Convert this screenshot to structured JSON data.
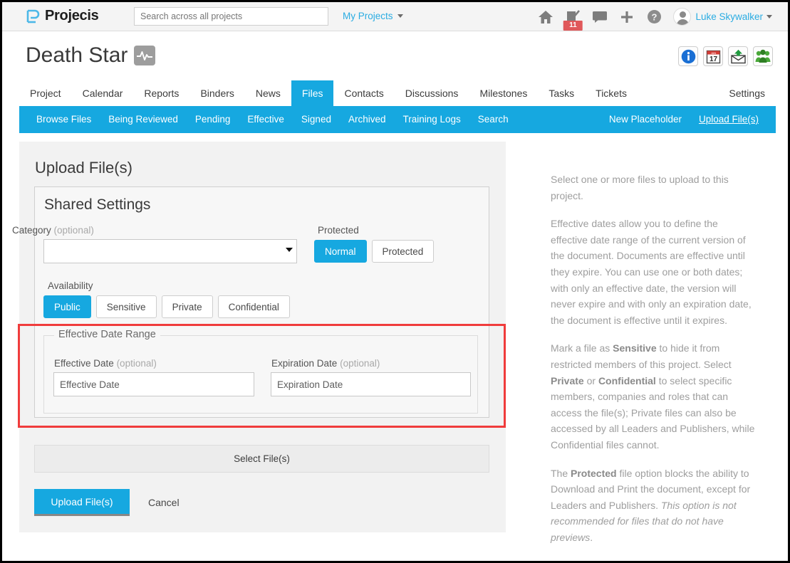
{
  "topbar": {
    "brand": "Projecis",
    "brand_logo_icon": "projecis-p-logo-icon",
    "search_placeholder": "Search across all projects",
    "search_value": "",
    "my_projects": "My Projects",
    "icons": [
      {
        "name": "home-icon",
        "label": "Home"
      },
      {
        "name": "tasks-checklist-icon",
        "label": "Tasks",
        "badge": "11"
      },
      {
        "name": "chat-bubble-icon",
        "label": "Messages"
      },
      {
        "name": "plus-icon",
        "label": "Add"
      },
      {
        "name": "help-question-icon",
        "label": "Help"
      }
    ],
    "badge_count": "11",
    "username": "Luke Skywalker",
    "avatar_icon": "user-avatar-icon"
  },
  "project": {
    "title": "Death Star",
    "status_icon": "activity-pulse-icon",
    "action_icons": [
      {
        "name": "info-icon",
        "label": "Project Info",
        "color": "#1a6fd4"
      },
      {
        "name": "calendar-icon",
        "label": "Calendar",
        "month": "JAN",
        "day": "17"
      },
      {
        "name": "email-upload-icon",
        "label": "Email Upload",
        "color": "#1f9a3e"
      },
      {
        "name": "members-group-icon",
        "label": "Members",
        "color": "#4aa83a"
      }
    ]
  },
  "main_tabs": [
    {
      "label": "Project",
      "active": false
    },
    {
      "label": "Calendar",
      "active": false
    },
    {
      "label": "Reports",
      "active": false
    },
    {
      "label": "Binders",
      "active": false
    },
    {
      "label": "News",
      "active": false
    },
    {
      "label": "Files",
      "active": true
    },
    {
      "label": "Contacts",
      "active": false
    },
    {
      "label": "Discussions",
      "active": false
    },
    {
      "label": "Milestones",
      "active": false
    },
    {
      "label": "Tasks",
      "active": false
    },
    {
      "label": "Tickets",
      "active": false
    }
  ],
  "main_tab_right": {
    "label": "Settings"
  },
  "sub_nav": [
    {
      "label": "Browse Files",
      "active": false
    },
    {
      "label": "Being Reviewed",
      "active": false
    },
    {
      "label": "Pending",
      "active": false
    },
    {
      "label": "Effective",
      "active": false
    },
    {
      "label": "Signed",
      "active": false
    },
    {
      "label": "Archived",
      "active": false
    },
    {
      "label": "Training Logs",
      "active": false
    },
    {
      "label": "Search",
      "active": false
    }
  ],
  "sub_nav_right": [
    {
      "label": "New Placeholder",
      "active": false
    },
    {
      "label": "Upload File(s)",
      "active": true
    }
  ],
  "main": {
    "page_heading": "Upload File(s)",
    "shared_settings_title": "Shared Settings",
    "category": {
      "label": "Category",
      "optional": "(optional)",
      "value": "",
      "options": [
        ""
      ]
    },
    "protected": {
      "label": "Protected",
      "options": [
        {
          "label": "Normal",
          "selected": true
        },
        {
          "label": "Protected",
          "selected": false
        }
      ]
    },
    "availability": {
      "label": "Availability",
      "options": [
        {
          "label": "Public",
          "selected": true
        },
        {
          "label": "Sensitive",
          "selected": false
        },
        {
          "label": "Private",
          "selected": false
        },
        {
          "label": "Confidential",
          "selected": false
        }
      ]
    },
    "effective_date_range": {
      "legend": "Effective Date Range",
      "effective_date": {
        "label": "Effective Date",
        "optional": "(optional)",
        "value": "",
        "placeholder": "Effective Date"
      },
      "expiration_date": {
        "label": "Expiration Date",
        "optional": "(optional)",
        "value": "",
        "placeholder": "Expiration Date"
      }
    },
    "select_files_label": "Select File(s)",
    "upload_button": "Upload File(s)",
    "cancel_link": "Cancel"
  },
  "help": {
    "p1": "Select one or more files to upload to this project.",
    "p2": "Effective dates allow you to define the effective date range of the current version of the document. Documents are effective until they expire. You can use one or both dates; with only an effective date, the version will never expire and with only an expiration date, the document is effective until it expires.",
    "p3a": "Mark a file as ",
    "p3b": "Sensitive",
    "p3c": " to hide it from restricted members of this project. Select ",
    "p3d": "Private",
    "p3e": " or ",
    "p3f": "Confidential",
    "p3g": " to select specific members, companies and roles that can access the file(s); Private files can also be accessed by all Leaders and Publishers, while Confidential files cannot.",
    "p4a": "The ",
    "p4b": "Protected",
    "p4c": " file option blocks the ability to Download and Print the document, except for Leaders and Publishers. ",
    "p4d": "This option is not recommended for files that do not have previews",
    "p4e": "."
  },
  "annotation": {
    "highlight_color": "#f03c3c",
    "highlight_target": "effective-date-range-fieldset"
  },
  "colors": {
    "accent": "#16a8e0",
    "topbar_bg": "#f4f4f4",
    "panel_bg": "#f2f2f2",
    "box_bg": "#f7f7f7",
    "help_text": "#9e9e9e"
  }
}
